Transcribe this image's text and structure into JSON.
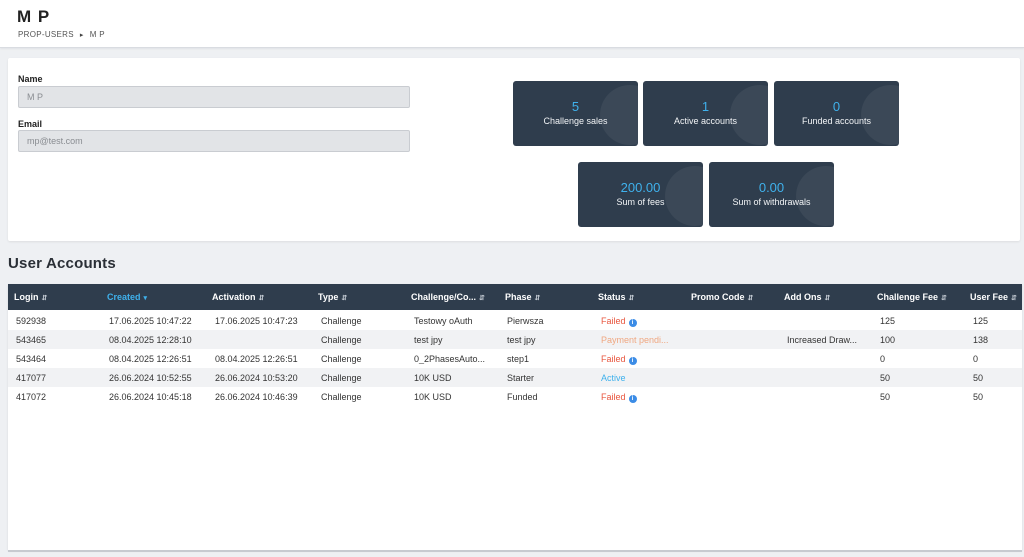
{
  "header": {
    "title": "M P",
    "breadcrumbs": [
      "PROP-USERS",
      "M P"
    ]
  },
  "profile": {
    "name_label": "Name",
    "name_value": "M P",
    "email_label": "Email",
    "email_value": "mp@test.com"
  },
  "stats": [
    {
      "value": "5",
      "label": "Challenge sales"
    },
    {
      "value": "1",
      "label": "Active accounts"
    },
    {
      "value": "0",
      "label": "Funded accounts"
    },
    {
      "value": "200.00",
      "label": "Sum of fees"
    },
    {
      "value": "0.00",
      "label": "Sum of withdrawals"
    }
  ],
  "accounts": {
    "title": "User Accounts",
    "columns": [
      "Login",
      "Created",
      "Activation",
      "Type",
      "Challenge/Co...",
      "Phase",
      "Status",
      "Promo Code",
      "Add Ons",
      "Challenge Fee",
      "User Fee"
    ],
    "rows": [
      {
        "login": "592938",
        "created": "17.06.2025 10:47:22",
        "activation": "17.06.2025 10:47:23",
        "type": "Challenge",
        "challenge": "Testowy oAuth",
        "phase": "Pierwsza",
        "status": "Failed",
        "status_kind": "failed",
        "promo": "",
        "addons": "",
        "challenge_fee": "125",
        "user_fee": "125"
      },
      {
        "login": "543465",
        "created": "08.04.2025 12:28:10",
        "activation": "",
        "type": "Challenge",
        "challenge": "test jpy",
        "phase": "test jpy",
        "status": "Payment pendi...",
        "status_kind": "pending",
        "promo": "",
        "addons": "Increased Draw...",
        "challenge_fee": "100",
        "user_fee": "138"
      },
      {
        "login": "543464",
        "created": "08.04.2025 12:26:51",
        "activation": "08.04.2025 12:26:51",
        "type": "Challenge",
        "challenge": "0_2PhasesAuto...",
        "phase": "step1",
        "status": "Failed",
        "status_kind": "failed",
        "promo": "",
        "addons": "",
        "challenge_fee": "0",
        "user_fee": "0"
      },
      {
        "login": "417077",
        "created": "26.06.2024 10:52:55",
        "activation": "26.06.2024 10:53:20",
        "type": "Challenge",
        "challenge": "10K USD",
        "phase": "Starter",
        "status": "Active",
        "status_kind": "active",
        "promo": "",
        "addons": "",
        "challenge_fee": "50",
        "user_fee": "50"
      },
      {
        "login": "417072",
        "created": "26.06.2024 10:45:18",
        "activation": "26.06.2024 10:46:39",
        "type": "Challenge",
        "challenge": "10K USD",
        "phase": "Funded",
        "status": "Failed",
        "status_kind": "failed",
        "promo": "",
        "addons": "",
        "challenge_fee": "50",
        "user_fee": "50"
      }
    ]
  },
  "colors": {
    "dark_panel": "#2f3d4d",
    "accent": "#3fb1ec",
    "failed": "#e8563f",
    "pending": "#f0a882"
  }
}
